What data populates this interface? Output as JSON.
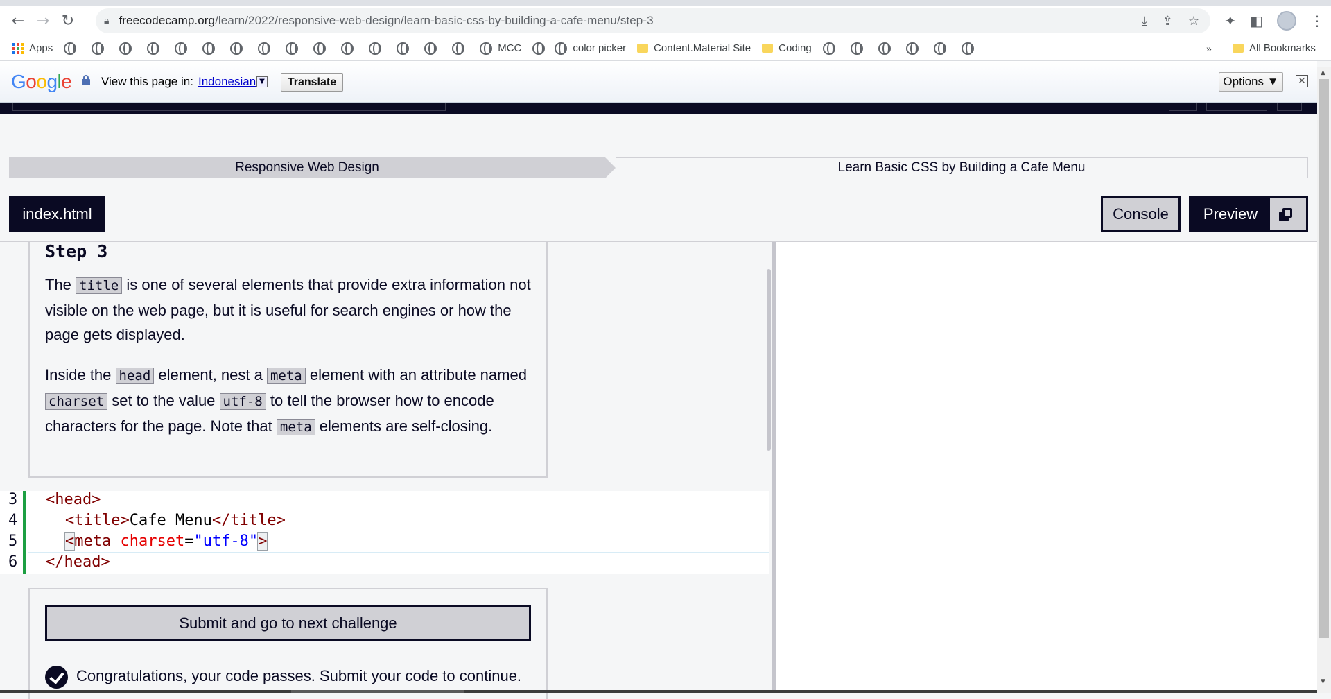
{
  "browser": {
    "url_host": "freecodecamp.org",
    "url_path": "/learn/2022/responsive-web-design/learn-basic-css-by-building-a-cafe-menu/step-3"
  },
  "bookmarks": {
    "apps_label": "Apps",
    "items": [
      "MCC",
      "color picker",
      "Content.Material Site",
      "Coding"
    ],
    "more_label": "»",
    "all_bookmarks_label": "All Bookmarks"
  },
  "translate_bar": {
    "view_text": "View this page in:",
    "language": "Indonesian",
    "translate_label": "Translate",
    "options_label": "Options ▼"
  },
  "breadcrumb": {
    "superblock": "Responsive Web Design",
    "block": "Learn Basic CSS by Building a Cafe Menu"
  },
  "editor_tabs": {
    "file_tab": "index.html",
    "console_label": "Console",
    "preview_label": "Preview"
  },
  "instructions": {
    "step_title": "Step 3",
    "p1": {
      "t1": "The",
      "c1": "title",
      "t2": "is one of several elements that provide extra information not visible on the web page, but it is useful for search engines or how the page gets displayed."
    },
    "p2": {
      "t1": "Inside the",
      "c1": "head",
      "t2": "element, nest a",
      "c2": "meta",
      "t3": "element with an attribute named",
      "c3": "charset",
      "t4": "set to the value",
      "c4": "utf-8",
      "t5": "to tell the browser how to encode characters for the page. Note that",
      "c5": "meta",
      "t6": "elements are self-closing."
    }
  },
  "code": {
    "line_numbers": [
      "3",
      "4",
      "5",
      "6"
    ],
    "l3_tag": "<head>",
    "l4_open": "<title>",
    "l4_text": "Cafe Menu",
    "l4_close": "</title>",
    "l5_lt": "<",
    "l5_tag": "meta",
    "l5_attr": "charset",
    "l5_eq": "=",
    "l5_val": "\"utf-8\"",
    "l5_gt": ">",
    "l6_tag": "</head>"
  },
  "submit": {
    "button_label": "Submit and go to next challenge",
    "pass_message": "Congratulations, your code passes. Submit your code to continue."
  }
}
